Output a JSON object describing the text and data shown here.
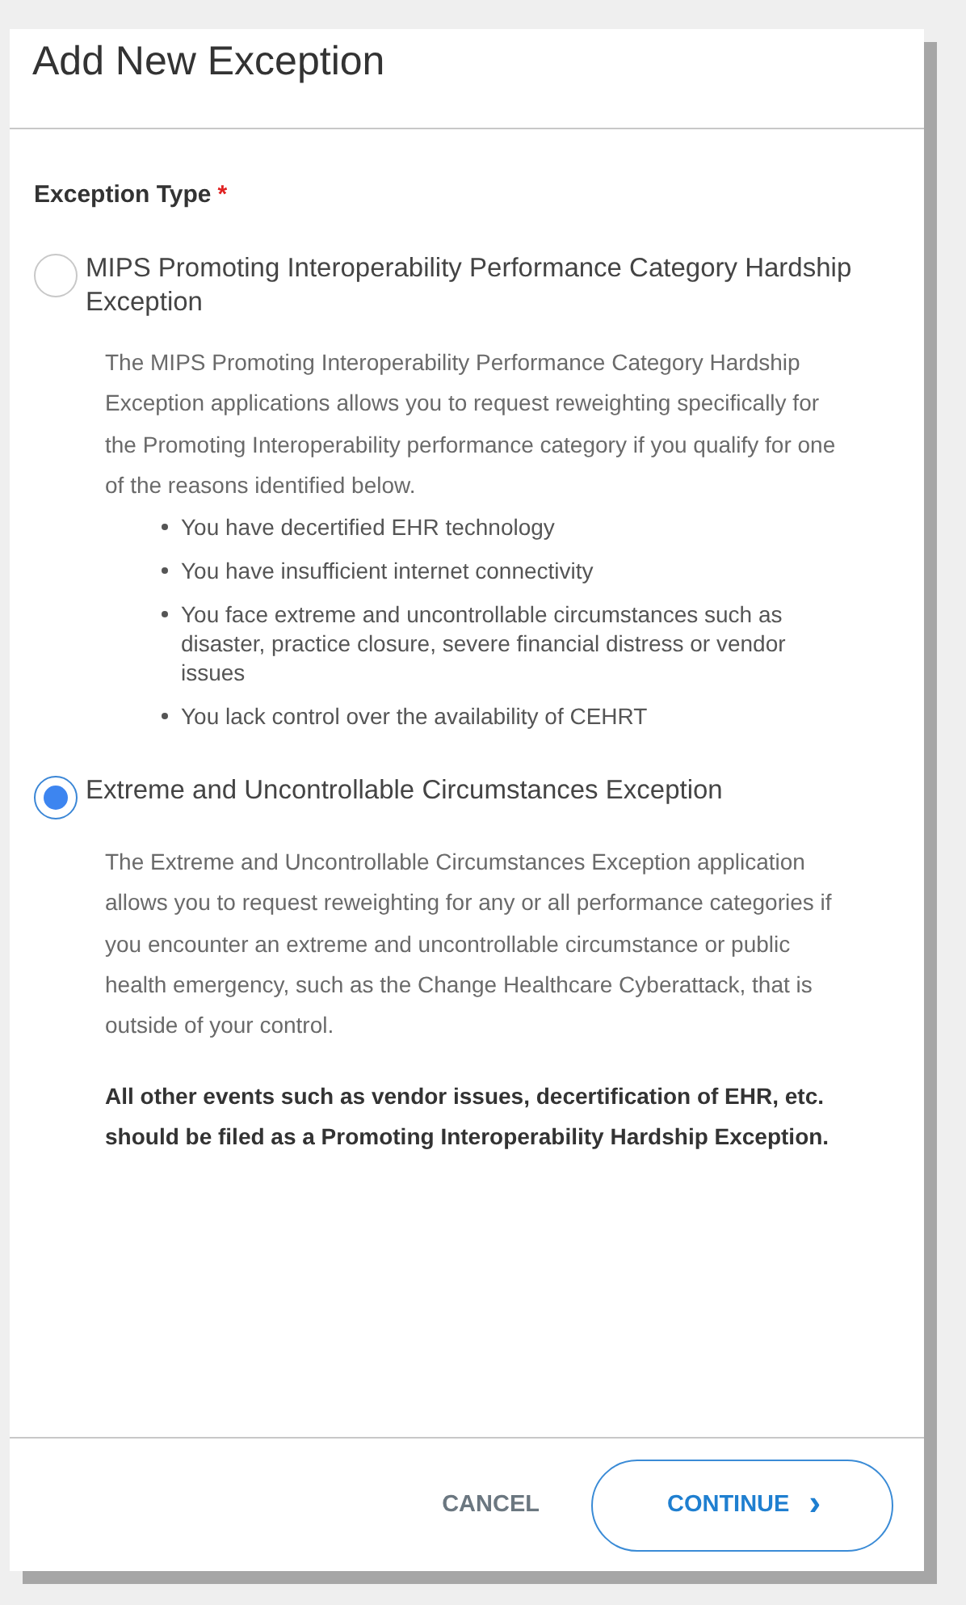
{
  "dialog": {
    "title": "Add New Exception",
    "field": {
      "label": "Exception Type",
      "required_mark": "*"
    },
    "options": [
      {
        "label": "MIPS Promoting Interoperability Performance Category Hardship Exception",
        "selected": false,
        "description": "The MIPS Promoting Interoperability Performance Category Hardship Exception applications allows you to request reweighting specifically for the Promoting Interoperability performance category if you qualify for one of the reasons identified below.",
        "bullets": [
          "You have decertified EHR technology",
          "You have insufficient internet connectivity",
          "You face extreme and uncontrollable circumstances such as disaster, practice closure, severe financial distress or vendor issues",
          "You lack control over the availability of CEHRT"
        ]
      },
      {
        "label": "Extreme and Uncontrollable Circumstances Exception",
        "selected": true,
        "description": "The Extreme and Uncontrollable Circumstances Exception application allows you to request reweighting for any or all performance categories if you encounter an extreme and uncontrollable circumstance or public health emergency, such as the Change Healthcare Cyberattack, that is outside of your control.",
        "note": "All other events such as vendor issues, decertification of EHR, etc. should be filed as a Promoting Interoperability Hardship Exception."
      }
    ],
    "buttons": [
      {
        "kind": "text",
        "label": "CANCEL"
      },
      {
        "kind": "outlined",
        "label": "CONTINUE",
        "icon": "›"
      }
    ]
  }
}
